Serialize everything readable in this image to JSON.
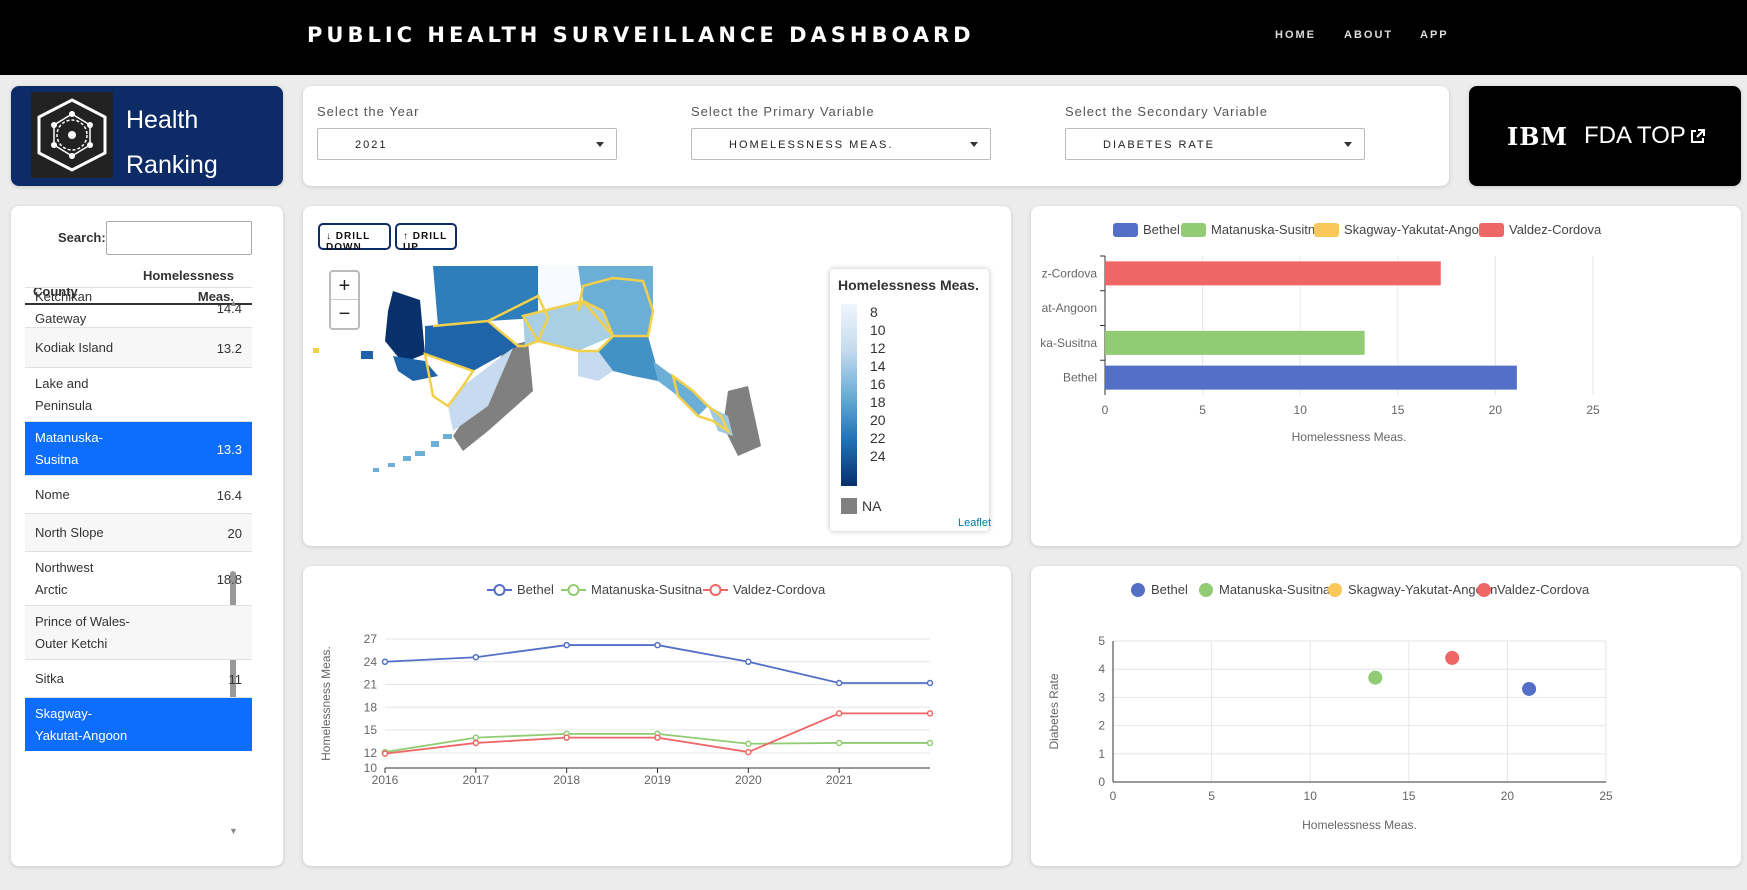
{
  "header": {
    "title": "PUBLIC HEALTH SURVEILLANCE DASHBOARD",
    "nav": [
      "HOME",
      "ABOUT",
      "APP"
    ]
  },
  "brand": {
    "line1": "Health",
    "line2": "Ranking",
    "logo_icon": "network-hexagon-icon"
  },
  "selectors": [
    {
      "label": "Select the Year",
      "value": "2021"
    },
    {
      "label": "Select the Primary Variable",
      "value": "HOMELESSNESS MEAS."
    },
    {
      "label": "Select the Secondary Variable",
      "value": "DIABETES RATE"
    }
  ],
  "fda": {
    "ibm_text": "IBM",
    "label": "FDA TOP",
    "icon": "external-link-icon"
  },
  "table": {
    "search_label": "Search:",
    "search_value": "",
    "col_county": "County",
    "col_measure_1": "Homelessness",
    "col_measure_2": "Meas.",
    "rows": [
      {
        "county": "Ketchikan Gateway",
        "l1": "Ketchikan",
        "l2": "Gateway",
        "value": "14.4",
        "selected": false
      },
      {
        "county": "Kodiak Island",
        "l1": "Kodiak Island",
        "l2": "",
        "value": "13.2",
        "selected": false
      },
      {
        "county": "Lake and Peninsula",
        "l1": "Lake and",
        "l2": "Peninsula",
        "value": "",
        "selected": false
      },
      {
        "county": "Matanuska-Susitna",
        "l1": "Matanuska-",
        "l2": "Susitna",
        "value": "13.3",
        "selected": true
      },
      {
        "county": "Nome",
        "l1": "Nome",
        "l2": "",
        "value": "16.4",
        "selected": false
      },
      {
        "county": "North Slope",
        "l1": "North Slope",
        "l2": "",
        "value": "20",
        "selected": false
      },
      {
        "county": "Northwest Arctic",
        "l1": "Northwest",
        "l2": "Arctic",
        "value": "18.8",
        "selected": false
      },
      {
        "county": "Prince of Wales-Outer Ketchi",
        "l1": "Prince of Wales-",
        "l2": "Outer Ketchi",
        "value": "",
        "selected": false
      },
      {
        "county": "Sitka",
        "l1": "Sitka",
        "l2": "",
        "value": "11",
        "selected": false
      },
      {
        "county": "Skagway-Yakutat-Angoon",
        "l1": "Skagway-",
        "l2": "Yakutat-Angoon",
        "value": "",
        "selected": true
      }
    ]
  },
  "map": {
    "drill_down": "DRILL DOWN",
    "drill_up": "DRILL UP",
    "zoom_in": "+",
    "zoom_out": "−",
    "legend_title": "Homelessness Meas.",
    "legend_ticks": [
      "8",
      "10",
      "12",
      "14",
      "16",
      "18",
      "20",
      "22",
      "24"
    ],
    "legend_na": "NA",
    "attribution": "Leaflet",
    "colors": {
      "low": "#eff6fc",
      "high": "#08306b",
      "na": "#808080",
      "highlight": "#f2d04b"
    }
  },
  "colors": {
    "Bethel": "#5470c6",
    "Matanuska-Susitna": "#91cc75",
    "Skagway-Yakutat-Angoon": "#fac858",
    "Valdez-Cordova": "#ee6666"
  },
  "chart_data": [
    {
      "type": "bar",
      "orientation": "horizontal",
      "legend": [
        "Bethel",
        "Matanuska-Susitna",
        "Skagway-Yakutat-Angoon",
        "Valdez-Cordova"
      ],
      "categories": [
        "Bethel",
        "ka-Susitna",
        "at-Angoon",
        "z-Cordova"
      ],
      "series_order": [
        "Bethel",
        "Matanuska-Susitna",
        "Skagway-Yakutat-Angoon",
        "Valdez-Cordova"
      ],
      "values": [
        21.1,
        13.3,
        0,
        17.2
      ],
      "xlabel": "Homelessness Meas.",
      "xlim": [
        0,
        25
      ],
      "xticks": [
        0,
        5,
        10,
        15,
        20,
        25
      ]
    },
    {
      "type": "line",
      "legend": [
        "Bethel",
        "Matanuska-Susitna",
        "Valdez-Cordova"
      ],
      "x": [
        2016,
        2017,
        2018,
        2019,
        2020,
        2021,
        2022
      ],
      "xticks": [
        "2016",
        "2017",
        "2018",
        "2019",
        "2020",
        "2021"
      ],
      "series": [
        {
          "name": "Bethel",
          "values": [
            24,
            24.6,
            26.2,
            26.2,
            24,
            21.2,
            21.2
          ]
        },
        {
          "name": "Matanuska-Susitna",
          "values": [
            12.1,
            14,
            14.5,
            14.5,
            13.2,
            13.3,
            13.3
          ]
        },
        {
          "name": "Valdez-Cordova",
          "values": [
            11.9,
            13.3,
            14,
            14,
            12.1,
            17.2,
            17.2
          ]
        }
      ],
      "ylabel": "Homelessness Meas.",
      "ylim": [
        10,
        27
      ],
      "yticks": [
        10,
        12,
        15,
        18,
        21,
        24,
        27
      ]
    },
    {
      "type": "scatter",
      "legend": [
        "Bethel",
        "Matanuska-Susitna",
        "Skagway-Yakutat-Angoon",
        "Valdez-Cordova"
      ],
      "points": [
        {
          "name": "Bethel",
          "x": 21.1,
          "y": 3.3
        },
        {
          "name": "Matanuska-Susitna",
          "x": 13.3,
          "y": 3.7
        },
        {
          "name": "Valdez-Cordova",
          "x": 17.2,
          "y": 4.4
        }
      ],
      "xlabel": "Homelessness Meas.",
      "ylabel": "Diabetes Rate",
      "xlim": [
        0,
        25
      ],
      "ylim": [
        0,
        5
      ],
      "xticks": [
        0,
        5,
        10,
        15,
        20,
        25
      ],
      "yticks": [
        0,
        1,
        2,
        3,
        4,
        5
      ]
    }
  ]
}
